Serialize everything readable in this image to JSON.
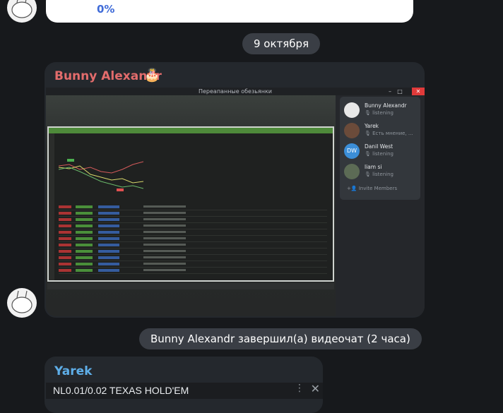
{
  "previous_message": {
    "percent": "0%"
  },
  "date_separator": "9 октября",
  "message_1": {
    "sender": "Bunny Alexandr",
    "sender_color": "#e36c6c",
    "screenshot": {
      "window_title": "Переапанные обезьянки",
      "members": [
        {
          "name": "Bunny Alexandr",
          "status": "listening"
        },
        {
          "name": "Yarek",
          "status": "Есть мнение, ..."
        },
        {
          "name": "Danil West",
          "initials": "DW",
          "status": "listening"
        },
        {
          "name": "liam si",
          "status": "listening"
        }
      ],
      "invite_label": "Invite Members"
    }
  },
  "service_message": "Bunny Alexandr завершил(а) видеочат (2 часа)",
  "message_2": {
    "sender": "Yarek",
    "sender_color": "#5eaee8",
    "embed_title": "NL0.01/0.02 TEXAS HOLD'EM"
  }
}
